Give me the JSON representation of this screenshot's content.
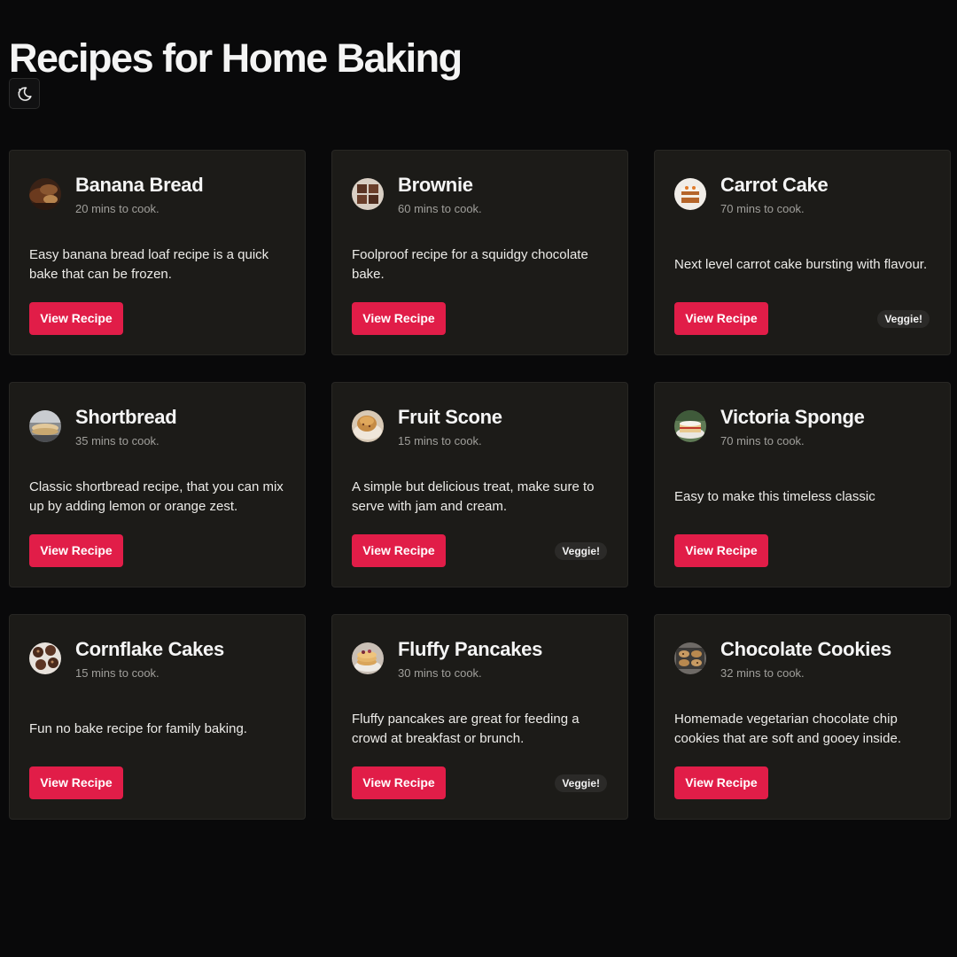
{
  "page": {
    "title": "Recipes for Home Baking",
    "theme_toggle_icon": "moon-sparkle-icon"
  },
  "colors": {
    "background": "#09090a",
    "card": "#1c1b18",
    "accent": "#e11d48",
    "badge": "#2b2a28"
  },
  "recipes": [
    {
      "name": "Banana Bread",
      "time": "20 mins to cook.",
      "description": "Easy banana bread loaf recipe is a quick bake that can be frozen.",
      "button": "View Recipe",
      "badge": "",
      "image": "banana-bread-image"
    },
    {
      "name": "Brownie",
      "time": "60 mins to cook.",
      "description": "Foolproof recipe for a squidgy chocolate bake.",
      "button": "View Recipe",
      "badge": "",
      "image": "brownie-image"
    },
    {
      "name": "Carrot Cake",
      "time": "70 mins to cook.",
      "description": "Next level carrot cake bursting with flavour.",
      "button": "View Recipe",
      "badge": "Veggie!",
      "image": "carrot-cake-image"
    },
    {
      "name": "Shortbread",
      "time": "35 mins to cook.",
      "description": "Classic shortbread recipe, that you can mix up by adding lemon or orange zest.",
      "button": "View Recipe",
      "badge": "",
      "image": "shortbread-image"
    },
    {
      "name": "Fruit Scone",
      "time": "15 mins to cook.",
      "description": "A simple but delicious treat, make sure to serve with jam and cream.",
      "button": "View Recipe",
      "badge": "Veggie!",
      "image": "fruit-scone-image"
    },
    {
      "name": "Victoria Sponge",
      "time": "70 mins to cook.",
      "description": "Easy to make this timeless classic",
      "button": "View Recipe",
      "badge": "",
      "image": "victoria-sponge-image"
    },
    {
      "name": "Cornflake Cakes",
      "time": "15 mins to cook.",
      "description": "Fun no bake recipe for family baking.",
      "button": "View Recipe",
      "badge": "",
      "image": "cornflake-cakes-image"
    },
    {
      "name": "Fluffy Pancakes",
      "time": "30 mins to cook.",
      "description": "Fluffy pancakes are great for feeding a crowd at breakfast or brunch.",
      "button": "View Recipe",
      "badge": "Veggie!",
      "image": "fluffy-pancakes-image"
    },
    {
      "name": "Chocolate Cookies",
      "time": "32 mins to cook.",
      "description": "Homemade vegetarian chocolate chip cookies that are soft and gooey inside.",
      "button": "View Recipe",
      "badge": "",
      "image": "chocolate-cookies-image"
    }
  ]
}
